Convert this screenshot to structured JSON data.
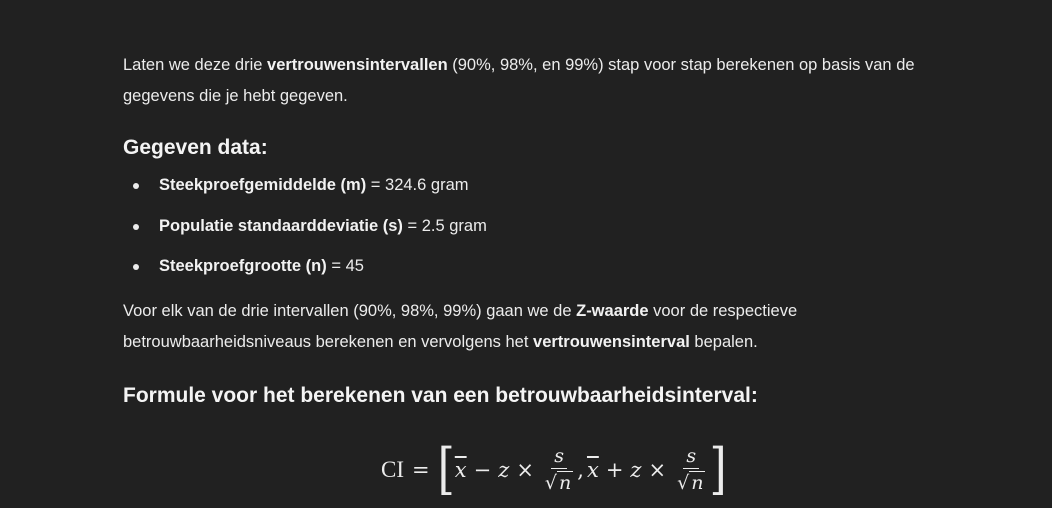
{
  "intro": {
    "pre": "Laten we deze drie ",
    "bold": "vertrouwensintervallen",
    "post": " (90%, 98%, en 99%) stap voor stap berekenen op basis van de gegevens die je hebt gegeven."
  },
  "data_heading": "Gegeven data:",
  "items": [
    {
      "label": "Steekproefgemiddelde (m)",
      "value": " = 324.6 gram"
    },
    {
      "label": "Populatie standaarddeviatie (s)",
      "value": " = 2.5 gram"
    },
    {
      "label": "Steekproefgrootte (n)",
      "value": " = 45"
    }
  ],
  "para2": {
    "pre": "Voor elk van de drie intervallen (90%, 98%, 99%) gaan we de ",
    "bold1": "Z-waarde",
    "mid": " voor de respectieve betrouwbaarheidsniveaus berekenen en vervolgens het ",
    "bold2": "vertrouwensinterval",
    "post": " bepalen."
  },
  "formula_heading": "Formule voor het berekenen van een betrouwbaarheidsinterval:",
  "formula": {
    "ci": "CI",
    "eq": "=",
    "open": "[",
    "xbar": "x",
    "minus": "−",
    "z": "z",
    "times": "×",
    "s": "s",
    "radical": "√",
    "n": "n",
    "comma": ",",
    "plus": "+",
    "close": "]"
  }
}
